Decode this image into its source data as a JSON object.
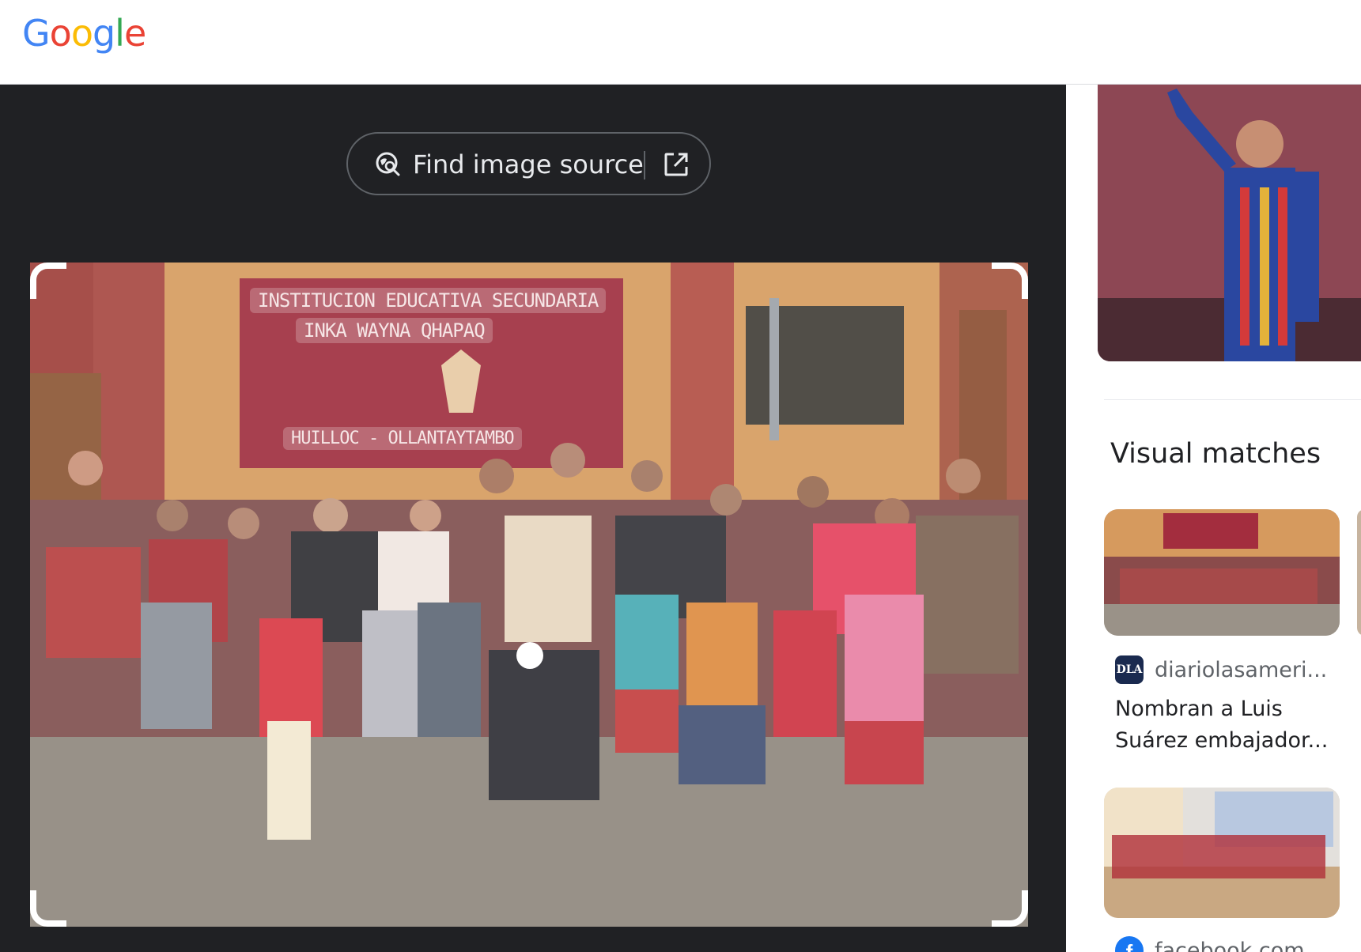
{
  "header": {
    "logo_letters": [
      {
        "char": "G",
        "color": "#4285F4"
      },
      {
        "char": "o",
        "color": "#EA4335"
      },
      {
        "char": "o",
        "color": "#FBBC05"
      },
      {
        "char": "g",
        "color": "#4285F4"
      },
      {
        "char": "l",
        "color": "#34A853"
      },
      {
        "char": "e",
        "color": "#EA4335"
      }
    ]
  },
  "main": {
    "find_button": {
      "label": "Find image source",
      "icon": "lens-search-icon",
      "open_icon": "open-in-new-icon"
    },
    "photo_banner": {
      "line1": "INSTITUCION EDUCATIVA SECUNDARIA",
      "line2": "INKA WAYNA QHAPAQ",
      "line3": "HUILLOC - OLLANTAYTAMBO"
    }
  },
  "sidebar": {
    "section_title": "Visual matches",
    "results": [
      {
        "source_icon": "DLA",
        "source": "diariolasameri...",
        "title_line1": "Nombran a Luis",
        "title_line2": "Suárez embajador..."
      },
      {
        "source_icon": "f",
        "source": "facebook.com",
        "title_line1": "",
        "title_line2": ""
      }
    ]
  },
  "colors": {
    "dark_panel": "#202124",
    "button_border": "#5f6368",
    "button_text": "#e8eaed",
    "facebook_blue": "#1877f2"
  }
}
